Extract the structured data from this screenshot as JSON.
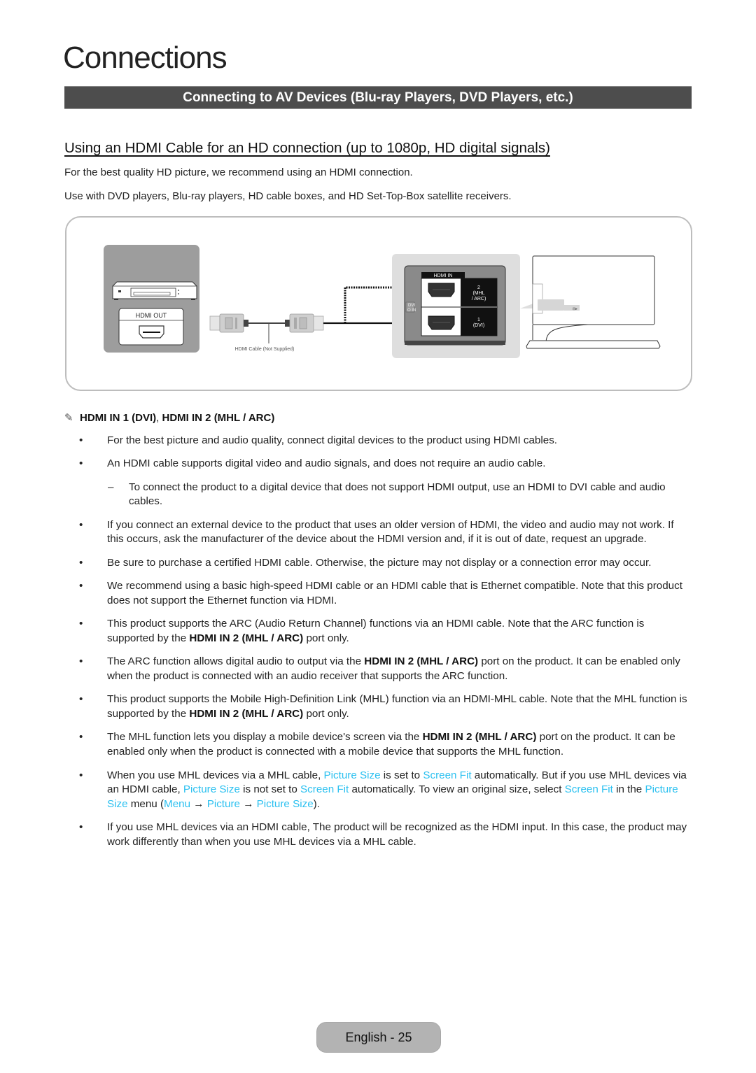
{
  "page": {
    "title": "Connections",
    "section_banner": "Connecting to AV Devices (Blu-ray Players, DVD Players, etc.)",
    "subheading": "Using an HDMI Cable for an HD connection (up to 1080p, HD digital signals)",
    "intro": [
      "For the best quality HD picture, we recommend using an HDMI connection.",
      "Use with DVD players, Blu-ray players, HD cable boxes, and HD Set-Top-Box satellite receivers."
    ]
  },
  "diagram": {
    "source_port_label": "HDMI OUT",
    "cable_label": "HDMI Cable (Not Supplied)",
    "tv_panel_header": "HDMI IN",
    "port_2_label": [
      "2",
      "(MHL",
      "/ ARC)"
    ],
    "port_1_label": [
      "1",
      "(DVI)"
    ],
    "side_label": [
      "DVI",
      "O IN"
    ]
  },
  "note": {
    "icon": "pencil-icon",
    "heading_part1": "HDMI IN 1 (DVI)",
    "separator": ",",
    "heading_part2": "HDMI IN 2 (MHL / ARC)"
  },
  "bullets": [
    {
      "type": "bullet",
      "segments": [
        {
          "t": "For the best picture and audio quality, connect digital devices to the product using HDMI cables."
        }
      ]
    },
    {
      "type": "bullet",
      "segments": [
        {
          "t": "An HDMI cable supports digital video and audio signals, and does not require an audio cable."
        }
      ]
    },
    {
      "type": "sub",
      "segments": [
        {
          "t": "To connect the product to a digital device that does not support HDMI output, use an HDMI to DVI cable and audio cables."
        }
      ]
    },
    {
      "type": "bullet",
      "segments": [
        {
          "t": "If you connect an external device to the product that uses an older version of HDMI, the video and audio may not work. If this occurs, ask the manufacturer of the device about the HDMI version and, if it is out of date, request an upgrade."
        }
      ]
    },
    {
      "type": "bullet",
      "segments": [
        {
          "t": "Be sure to purchase a certified HDMI cable. Otherwise, the picture may not display or a connection error may occur."
        }
      ]
    },
    {
      "type": "bullet",
      "segments": [
        {
          "t": "We recommend using a basic high-speed HDMI cable or an HDMI cable that is Ethernet compatible. Note that this product does not support the Ethernet function via HDMI."
        }
      ]
    },
    {
      "type": "bullet",
      "segments": [
        {
          "t": "This product supports the ARC (Audio Return Channel) functions via an HDMI cable. Note that the ARC function is supported by the "
        },
        {
          "t": "HDMI IN 2 (MHL / ARC)",
          "s": "b"
        },
        {
          "t": " port only."
        }
      ]
    },
    {
      "type": "bullet",
      "segments": [
        {
          "t": "The ARC function allows digital audio to output via the "
        },
        {
          "t": "HDMI IN 2 (MHL / ARC)",
          "s": "b"
        },
        {
          "t": " port on the product. It can be enabled only when the product is connected with an audio receiver that supports the ARC function."
        }
      ]
    },
    {
      "type": "bullet",
      "segments": [
        {
          "t": "This product supports the Mobile High-Definition Link (MHL) function via an HDMI-MHL cable. Note that the MHL function is supported by the "
        },
        {
          "t": "HDMI IN 2 (MHL / ARC)",
          "s": "b"
        },
        {
          "t": " port only."
        }
      ]
    },
    {
      "type": "bullet",
      "segments": [
        {
          "t": "The MHL function lets you display a mobile device's screen via the "
        },
        {
          "t": "HDMI IN 2 (MHL / ARC)",
          "s": "b"
        },
        {
          "t": " port on the product. It can be enabled only when the product is connected with a mobile device that supports the MHL function."
        }
      ]
    },
    {
      "type": "bullet",
      "segments": [
        {
          "t": "When you use MHL devices via a MHL cable, "
        },
        {
          "t": "Picture Size",
          "s": "hl"
        },
        {
          "t": " is set to "
        },
        {
          "t": "Screen Fit",
          "s": "hl"
        },
        {
          "t": " automatically. But if you use MHL devices via an HDMI cable, "
        },
        {
          "t": "Picture Size",
          "s": "hl"
        },
        {
          "t": " is not set to "
        },
        {
          "t": "Screen Fit",
          "s": "hl"
        },
        {
          "t": " automatically. To view an original size, select "
        },
        {
          "t": "Screen Fit",
          "s": "hl"
        },
        {
          "t": " in the "
        },
        {
          "t": "Picture Size",
          "s": "hl"
        },
        {
          "t": " menu ("
        },
        {
          "t": "Menu",
          "s": "hl"
        },
        {
          "t": " → "
        },
        {
          "t": "Picture",
          "s": "hl"
        },
        {
          "t": " → "
        },
        {
          "t": "Picture Size",
          "s": "hl"
        },
        {
          "t": ")."
        }
      ]
    },
    {
      "type": "bullet",
      "segments": [
        {
          "t": "If you use MHL devices via an HDMI cable, The product will be recognized as the HDMI input. In this case, the product may work differently than when you use MHL devices via a MHL cable."
        }
      ]
    }
  ],
  "glyphs": {
    "bullet": "•",
    "dash": "–",
    "pencil": "✎"
  },
  "colors": {
    "banner": "#4d4d4d",
    "highlight": "#2ac0f0",
    "footer_pill": "#b3b3b3"
  },
  "footer": {
    "page_label": "English - 25"
  }
}
